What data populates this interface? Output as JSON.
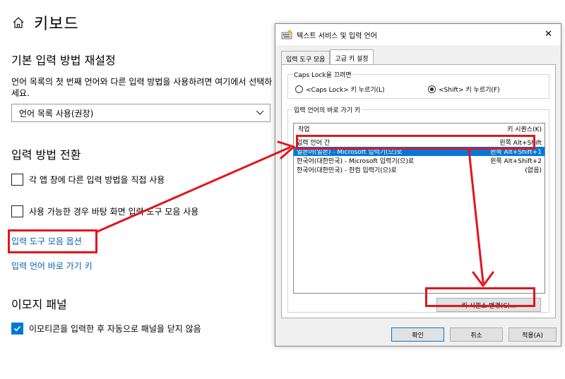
{
  "settings": {
    "title": "키보드",
    "section_default_input": "기본 입력 방법 재설정",
    "description": "언어 목록의 첫 번째 언어와 다른 입력 방법을 사용하려면 여기에서 선택하세요.",
    "dropdown_value": "언어 목록 사용(권장)",
    "section_switch": "입력 방법 전환",
    "chk_per_app": "각 앱 창에 다른 입력 방법을 직접 사용",
    "chk_desktop_bar": "사용 가능한 경우 바탕 화면 입력 도구 모음 사용",
    "link_toolbar_options": "입력 도구 모음 옵션",
    "link_hotkeys": "입력 언어 바로 가기 키",
    "section_emoji": "이모지 패널",
    "chk_emoji": "이모티콘을 입력한 후 자동으로 패널을 닫지 않음"
  },
  "dialog": {
    "title": "텍스트 서비스 및 입력 언어",
    "close": "✕",
    "tabs": [
      "입력 도구 모음",
      "고급 키 설정"
    ],
    "caps_group": "Caps Lock을 끄려면",
    "radio_caps": "<Caps Lock> 키 누르기(L)",
    "radio_shift": "<Shift> 키 누르기(F)",
    "hotkey_group": "입력 언어의 바로 가기 키",
    "col_action": "작업",
    "col_sequence": "키 시퀀스(K)",
    "rows": [
      {
        "action": "입력 언어 간",
        "keys": "왼쪽 Alt+Shift"
      },
      {
        "action": "일본어(일본) - Microsoft 입력기(으)로",
        "keys": "왼쪽 Alt+Shift+1"
      },
      {
        "action": "한국어(대한민국) - Microsoft 입력기(으)로",
        "keys": "왼쪽 Alt+Shift+2"
      },
      {
        "action": "한국어(대한민국) - 한컴 입력기(으)로",
        "keys": "(없음)"
      }
    ],
    "change_sequence_button": "키 시퀀스 변경(C)...",
    "ok": "확인",
    "cancel": "취소",
    "apply": "적용(A)"
  },
  "colors": {
    "annotation_red": "#e0161e",
    "selection_blue": "#0078d7",
    "link_blue": "#0063b1"
  }
}
